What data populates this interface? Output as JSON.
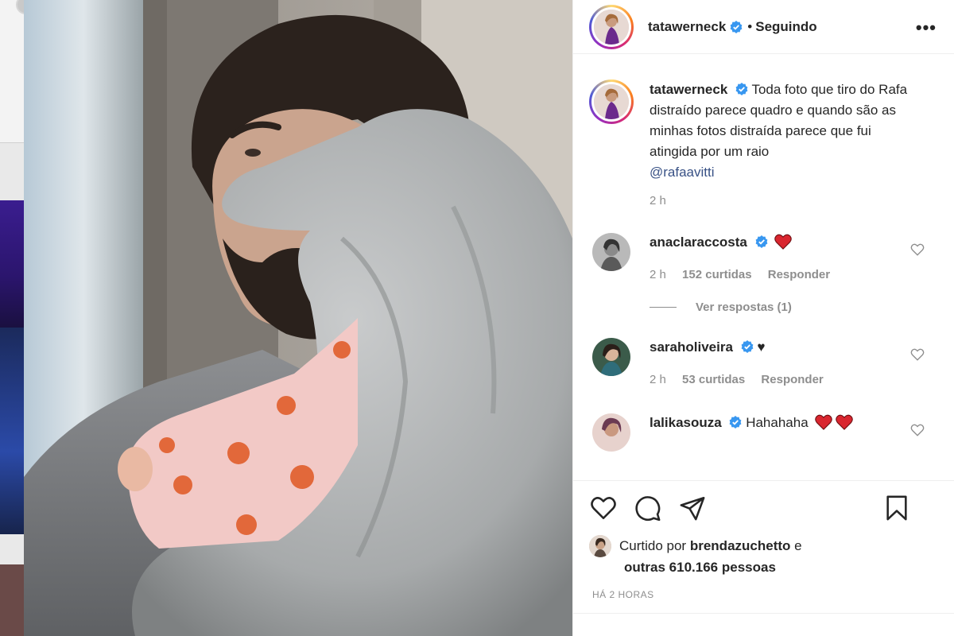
{
  "post": {
    "username": "tatawerneck",
    "separator": "•",
    "follow_status": "Seguindo",
    "more_label": "•••",
    "caption_user": "tatawerneck",
    "caption_text": "Toda foto que tiro do Rafa distraído parece quadro e quando são as minhas fotos distraída parece que fui atingida por um raio",
    "caption_mention": "@rafaavitti",
    "caption_time": "2 h"
  },
  "comments": [
    {
      "user": "anaclaraccosta",
      "text": "",
      "emoji": "red-heart",
      "time": "2 h",
      "likes": "152 curtidas",
      "reply": "Responder",
      "view_replies": "Ver respostas (1)"
    },
    {
      "user": "saraholiveira",
      "text": "♥",
      "time": "2 h",
      "likes": "53 curtidas",
      "reply": "Responder"
    },
    {
      "user": "lalikasouza",
      "text": "Hahahaha",
      "emoji": "red-heart-double"
    }
  ],
  "likes": {
    "prefix": "Curtido por",
    "user": "brendazuchetto",
    "joiner": "e",
    "others": "outras 610.166 pessoas"
  },
  "posted_time": "HÁ 2 HORAS",
  "icons": {
    "like": "heart-outline-icon",
    "comment": "comment-bubble-icon",
    "share": "paper-plane-icon",
    "save": "bookmark-icon",
    "verified": "verified-badge-icon"
  },
  "colors": {
    "accent_link": "#385185",
    "verified_blue": "#3897f0",
    "heart_red": "#ed4956",
    "text": "#262626",
    "muted": "#8e8e8e"
  }
}
